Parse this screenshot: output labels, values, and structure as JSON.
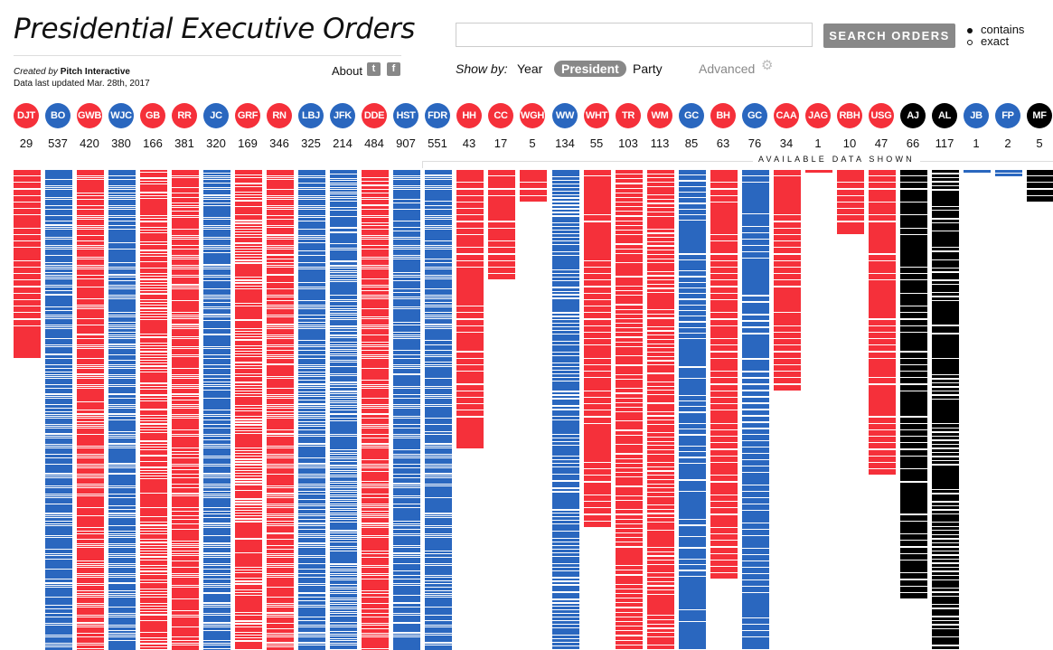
{
  "header": {
    "title": "Presidential Executive Orders",
    "created_by_prefix": "Created by",
    "created_by_name": "Pitch Interactive",
    "updated": "Data last updated Mar. 28th, 2017",
    "about_label": "About",
    "twitter_icon": "twitter-icon",
    "facebook_icon": "facebook-icon"
  },
  "search": {
    "value": "",
    "placeholder": "",
    "button_label": "SEARCH ORDERS",
    "modes": [
      {
        "label": "contains",
        "selected": true
      },
      {
        "label": "exact",
        "selected": false
      }
    ]
  },
  "view": {
    "show_by_label": "Show by:",
    "options": [
      "Year",
      "President",
      "Party"
    ],
    "active": "President",
    "advanced_label": "Advanced",
    "advanced_icon": "gear-icon"
  },
  "colors": {
    "republican": "#f5303a",
    "democrat": "#2a67bf",
    "other": "#000000"
  },
  "available_label": "AVAILABLE DATA SHOWN",
  "chart_data": {
    "type": "bar",
    "title": "Presidential Executive Orders",
    "description": "Stacked stripe columns, one stripe per executive order, grouped by president (newest left). Columns for presidents from DJT through HST/WW extend beyond the visible area.",
    "categories": [
      "DJT",
      "BO",
      "GWB",
      "WJC",
      "GB",
      "RR",
      "JC",
      "GRF",
      "RN",
      "LBJ",
      "JFK",
      "DDE",
      "HST",
      "FDR",
      "HH",
      "CC",
      "WGH",
      "WW",
      "WHT",
      "TR",
      "WM",
      "GC",
      "BH",
      "GC",
      "CAA",
      "JAG",
      "RBH",
      "USG",
      "AJ",
      "AL",
      "JB",
      "FP",
      "MF"
    ],
    "parties": [
      "R",
      "D",
      "R",
      "D",
      "R",
      "R",
      "D",
      "R",
      "R",
      "D",
      "D",
      "R",
      "D",
      "D",
      "R",
      "R",
      "R",
      "D",
      "R",
      "R",
      "R",
      "D",
      "R",
      "D",
      "R",
      "R",
      "R",
      "R",
      "O",
      "O",
      "D",
      "D",
      "O"
    ],
    "values": [
      29,
      537,
      420,
      380,
      166,
      381,
      320,
      169,
      346,
      325,
      214,
      484,
      907,
      551,
      43,
      17,
      5,
      134,
      55,
      103,
      113,
      85,
      63,
      76,
      34,
      1,
      10,
      47,
      66,
      117,
      1,
      2,
      5
    ],
    "available_data_note": "AVAILABLE DATA SHOWN",
    "legend": "circle color = party (red Republican, blue Democrat, black Whig/other)"
  }
}
